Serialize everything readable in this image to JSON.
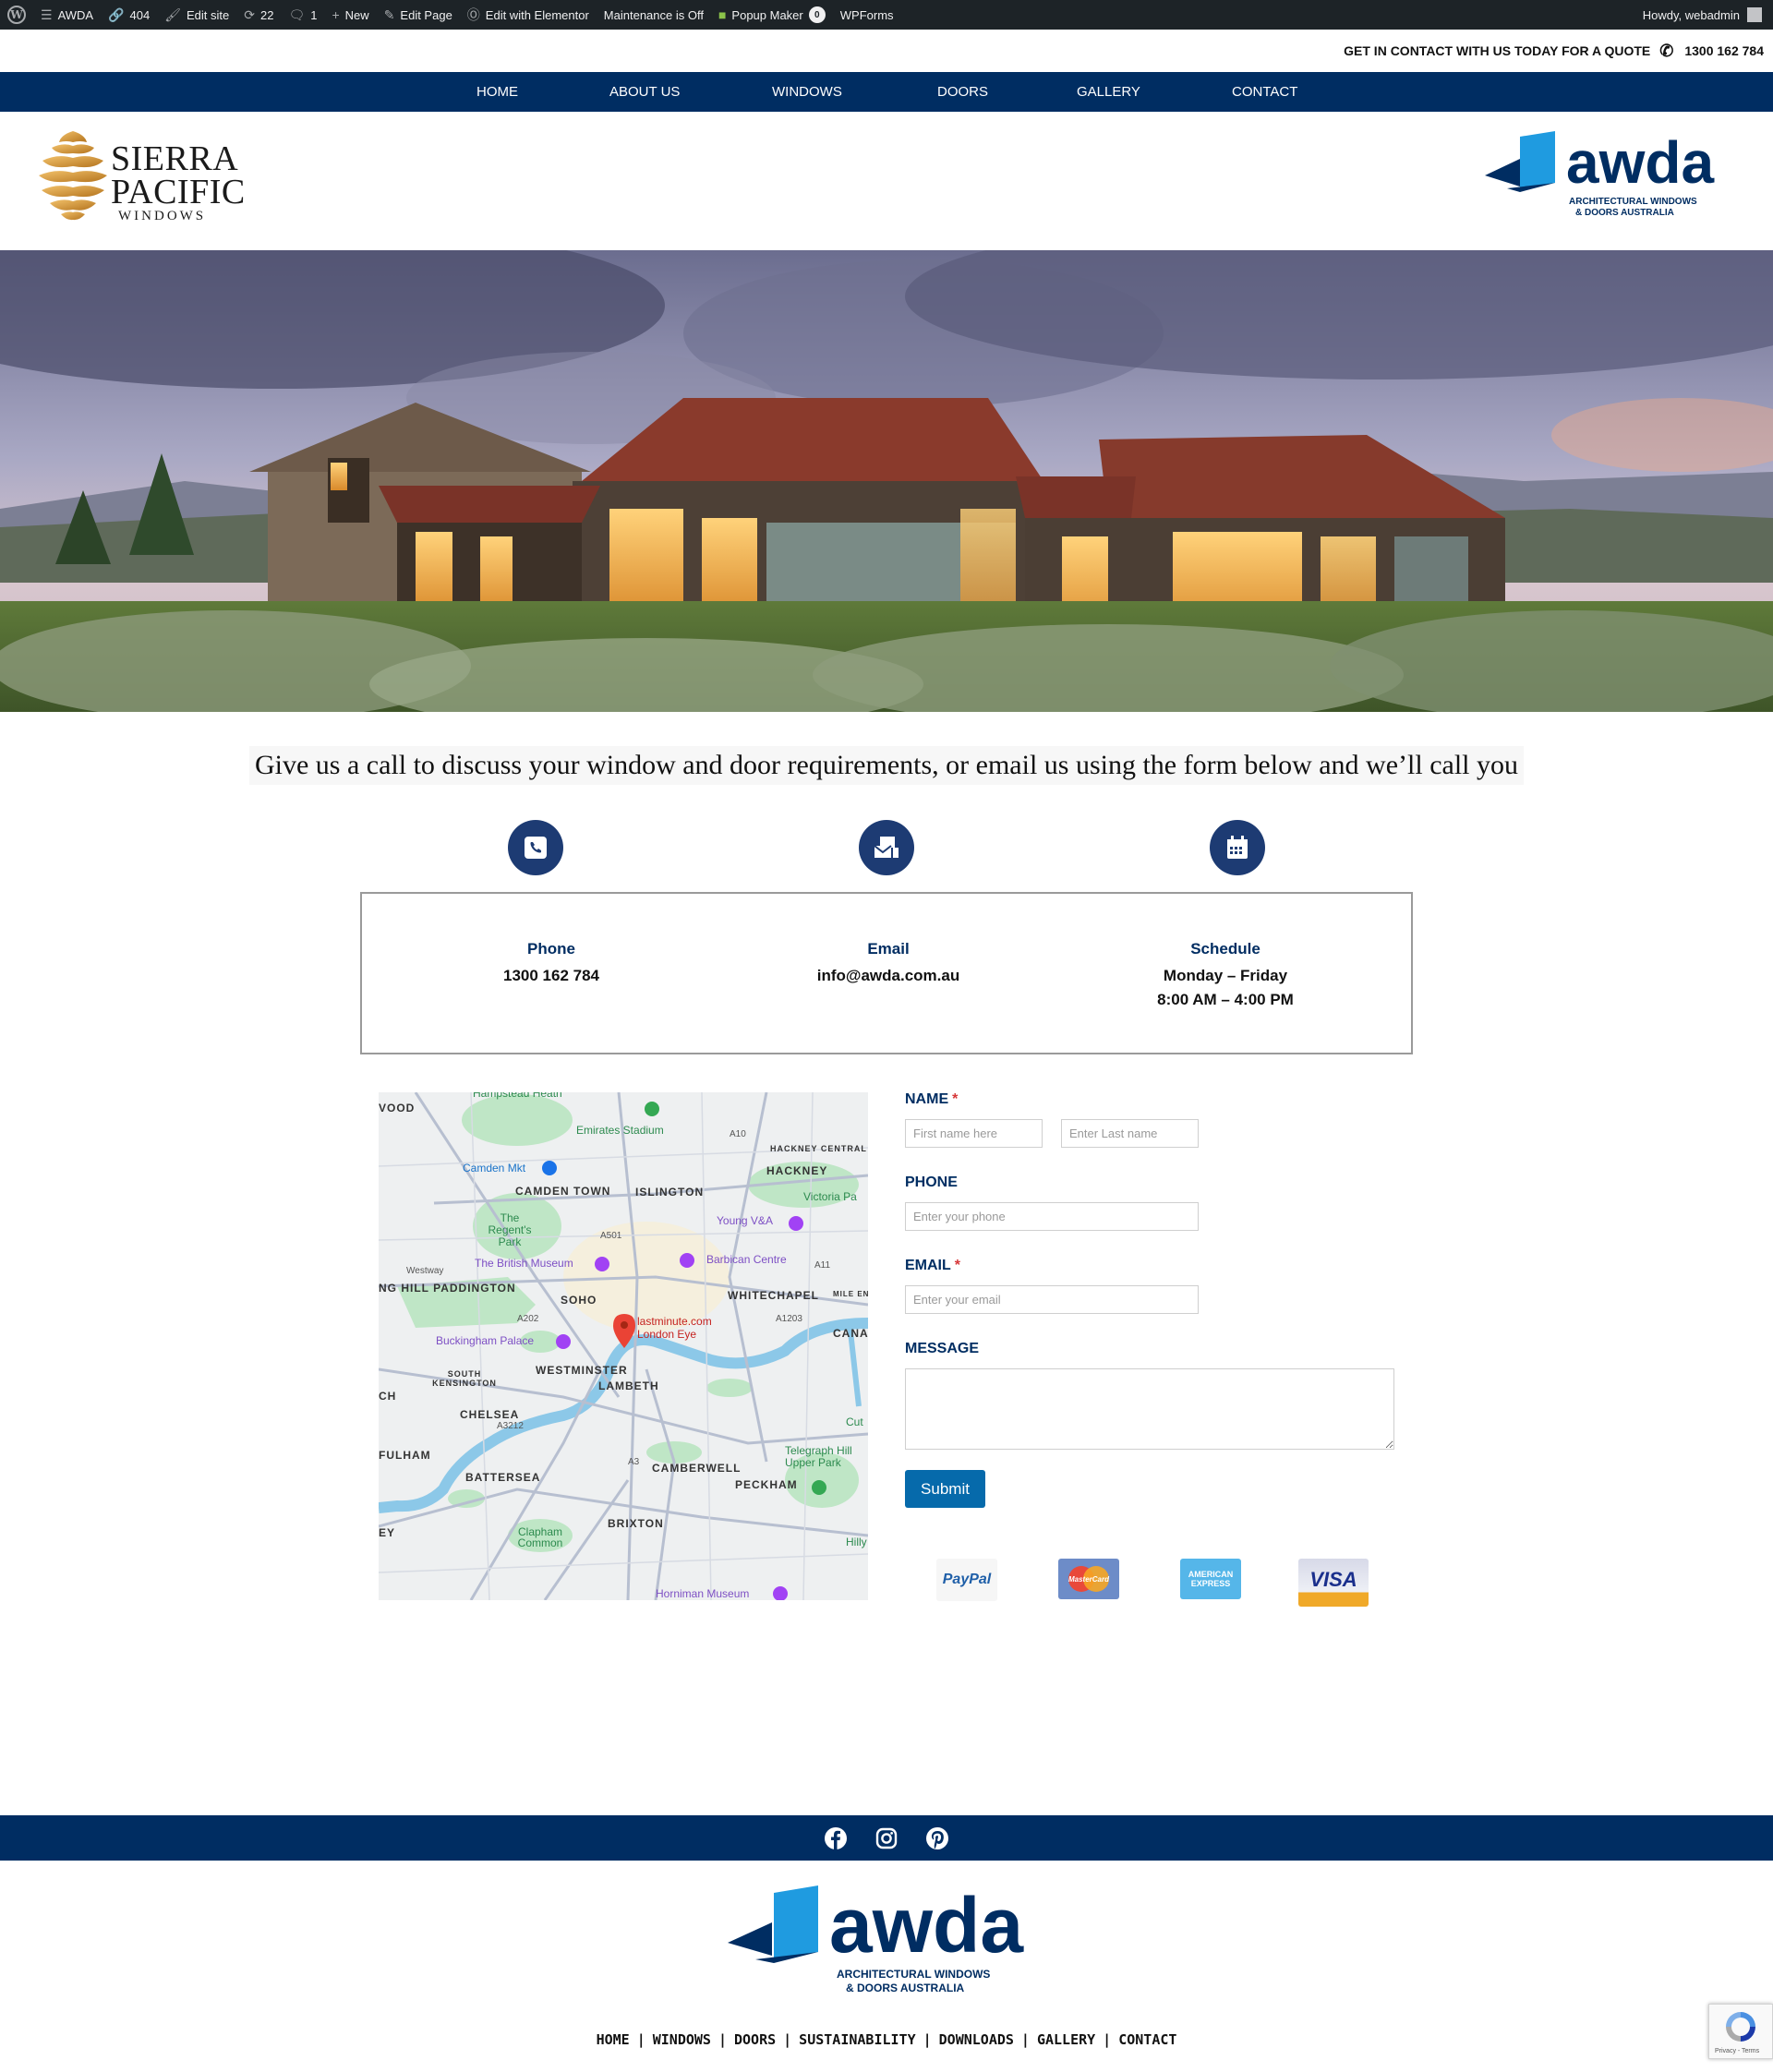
{
  "adminbar": {
    "site_name": "AWDA",
    "errors": "404",
    "edit_site": "Edit site",
    "updates": "22",
    "comments": "1",
    "new": "New",
    "edit_page": "Edit Page",
    "elementor": "Edit with Elementor",
    "maintenance": "Maintenance is Off",
    "popup_maker": "Popup Maker",
    "popup_count": "0",
    "wpforms": "WPForms",
    "howdy": "Howdy, webadmin"
  },
  "topbar": {
    "cta": "GET IN CONTACT WITH US TODAY FOR A QUOTE",
    "phone": "1300 162 784"
  },
  "nav": {
    "items": [
      "HOME",
      "ABOUT US",
      "WINDOWS",
      "DOORS",
      "GALLERY",
      "CONTACT"
    ]
  },
  "logos": {
    "sierra_line1": "SIERRA",
    "sierra_line2": "PACIFIC",
    "sierra_line3": "WINDOWS",
    "awda_word": "awda",
    "awda_tag1": "ARCHITECTURAL WINDOWS",
    "awda_tag2": "& DOORS AUSTRALIA"
  },
  "intro": "Give us a call to discuss your window and door requirements, or email us using the form below and we’ll call you",
  "contact": {
    "phone_label": "Phone",
    "phone_value": "1300 162 784",
    "email_label": "Email",
    "email_value": "info@awda.com.au",
    "schedule_label": "Schedule",
    "schedule_days": "Monday – Friday",
    "schedule_hours": "8:00 AM – 4:00 PM"
  },
  "map": {
    "labels": {
      "hampstead": "Hampstead Heath",
      "emirates": "Emirates Stadium",
      "camden_mkt": "Camden Mkt",
      "hackney_central": "HACKNEY CENTRAL",
      "hackney": "HACKNEY",
      "camden_town": "CAMDEN TOWN",
      "islington": "ISLINGTON",
      "victoria_pa": "Victoria Pa",
      "regents_park": "The Regent's Park",
      "young_va": "Young V&A",
      "british_museum": "The British Museum",
      "barbican": "Barbican Centre",
      "paddington": "NG HILL  PADDINGTON",
      "soho": "SOHO",
      "whitechapel": "WHITECHAPEL",
      "pin": "lastminute.com London Eye",
      "buckingham": "Buckingham Palace",
      "south_kensington": "SOUTH KENSINGTON",
      "westminster": "WESTMINSTER",
      "lambeth": "LAMBETH",
      "chelsea": "CHELSEA",
      "fulham": "FULHAM",
      "battersea": "BATTERSEA",
      "camberwell": "CAMBERWELL",
      "telegraph": "Telegraph Hill Upper Park",
      "peckham": "PECKHAM",
      "clapham": "Clapham Common",
      "brixton": "BRIXTON",
      "horniman": "Horniman Museum",
      "hilly": "Hilly",
      "cut": "Cut",
      "cana": "CANA",
      "wood": "VOOD",
      "ey": "EY",
      "ch": "CH",
      "mile_end": "MILE EN",
      "road_a10": "A10",
      "road_a501": "A501",
      "road_a1203": "A1203",
      "road_a3212": "A3212",
      "road_a3": "A3",
      "road_a202": "A202",
      "road_westway": "Westway",
      "road_a11": "A11"
    }
  },
  "form": {
    "name_label": "NAME",
    "first_placeholder": "First name here",
    "last_placeholder": "Enter Last name",
    "phone_label": "PHONE",
    "phone_placeholder": "Enter your phone",
    "email_label": "EMAIL",
    "email_placeholder": "Enter your email",
    "message_label": "MESSAGE",
    "required_mark": "*",
    "submit": "Submit"
  },
  "payments": {
    "paypal": "PayPal",
    "mastercard": "MasterCard",
    "amex_line1": "AMERICAN",
    "amex_line2": "EXPRESS",
    "visa": "VISA"
  },
  "footer": {
    "nav": [
      "HOME",
      "WINDOWS",
      "DOORS",
      "SUSTAINABILITY",
      "DOWNLOADS",
      "GALLERY",
      "CONTACT"
    ],
    "separator": "|",
    "recaptcha": "Privacy - Terms"
  },
  "colors": {
    "navy": "#002d62",
    "icon_circle": "#1d3b73",
    "submit": "#066aab",
    "admin_bar": "#1d2327",
    "awda_blue": "#1f9be0"
  }
}
